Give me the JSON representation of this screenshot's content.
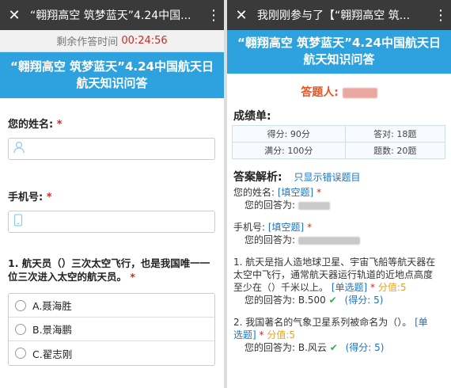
{
  "left": {
    "window_title": "“翱翔高空 筑梦蓝天”4.24中国...",
    "timer_label": "剩余作答时间",
    "timer_value": "00:24:56",
    "banner_title_1": "“翱翔高空 筑梦蓝天”4.24中国航天日",
    "banner_title_2": "航天知识问答",
    "name_label": "您的姓名:",
    "phone_label": "手机号:",
    "q1_line1": "1. 航天员（）三次太空飞行，也是我国唯一一",
    "q1_line2": "位三次进入太空的航天员。",
    "options": [
      "A.聂海胜",
      "B.景海鹏",
      "C.翟志刚"
    ],
    "req_mark": "*"
  },
  "right": {
    "window_title": "我刚刚参与了【“翱翔高空 筑...",
    "banner_title_1": "“翱翔高空 筑梦蓝天”4.24中国航天日",
    "banner_title_2": "航天知识问答",
    "answerer_label": "答题人:",
    "score_title": "成绩单:",
    "score": {
      "got": "得分: 90分",
      "correct": "答对: 18题",
      "full": "满分: 100分",
      "count": "题数: 20题"
    },
    "analysis_title": "答案解析:",
    "only_wrong_link": "只显示错误题目",
    "name_q": "您的姓名:",
    "fill_tag": "[填空题]",
    "your_answer": "您的回答为:",
    "phone_q": "手机号:",
    "q1_l1": "1. 航天是指人造地球卫星、宇宙飞船等航天器在",
    "q1_l2": "太空中飞行，通常航天器运行轨道的近地点高度",
    "q1_l3": "至少在（）千米以上。",
    "single_tag": "[单选题]",
    "score_tag": "分值:5",
    "q1_answer": "您的回答为: B.500",
    "q1_points": "(得分: 5)",
    "q2_l1": "2. 我国著名的气象卫星系列被命名为（）。",
    "q2_tag_a": "[单",
    "q2_tag_b": "选题]",
    "q2_answer": "您的回答为: B.风云",
    "q2_points": "(得分: 5)",
    "req_mark": "*"
  }
}
